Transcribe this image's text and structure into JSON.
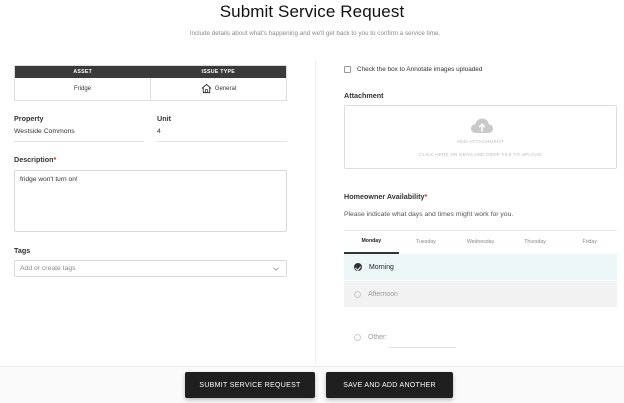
{
  "header": {
    "title": "Submit Service Request",
    "subtitle": "Include details about what's happening and we'll get back to you to confirm a service time."
  },
  "asset_table": {
    "col_asset": "ASSET",
    "col_issue_type": "ISSUE TYPE",
    "asset_value": "Fridge",
    "issue_type_value": "General",
    "issue_icon": "house-icon"
  },
  "property": {
    "label": "Property",
    "value": "Westside Commons"
  },
  "unit": {
    "label": "Unit",
    "value": "4"
  },
  "description": {
    "label": "Description",
    "required_mark": "*",
    "value": "fridge won't turn on!"
  },
  "tags": {
    "label": "Tags",
    "placeholder": "Add or create tags"
  },
  "annotate": {
    "label": "Check the box to Annotate images uploaded",
    "checked": false
  },
  "attachment": {
    "label": "Attachment",
    "main_text": "ADD ATTACHMENT",
    "sub_text": "CLICK HERE OR DRAG AND DROP FILE TO UPLOAD",
    "icon": "cloud-upload-icon"
  },
  "availability": {
    "label": "Homeowner Availability",
    "required_mark": "*",
    "hint": "Please indicate what days and times might work for you.",
    "days": [
      "Monday",
      "Tuesday",
      "Wednesday",
      "Thursday",
      "Friday"
    ],
    "active_day": "Monday",
    "slots": [
      "Morning",
      "Afternoon",
      "Other:"
    ],
    "selected_slot": "Morning"
  },
  "footer": {
    "submit_label": "SUBMIT SERVICE REQUEST",
    "save_label": "SAVE AND ADD ANOTHER"
  },
  "colors": {
    "button_bg": "#1f1f1f",
    "table_header_bg": "#3a3a3a",
    "selected_slot_bg": "#eef7f8",
    "required": "#c0392b"
  }
}
